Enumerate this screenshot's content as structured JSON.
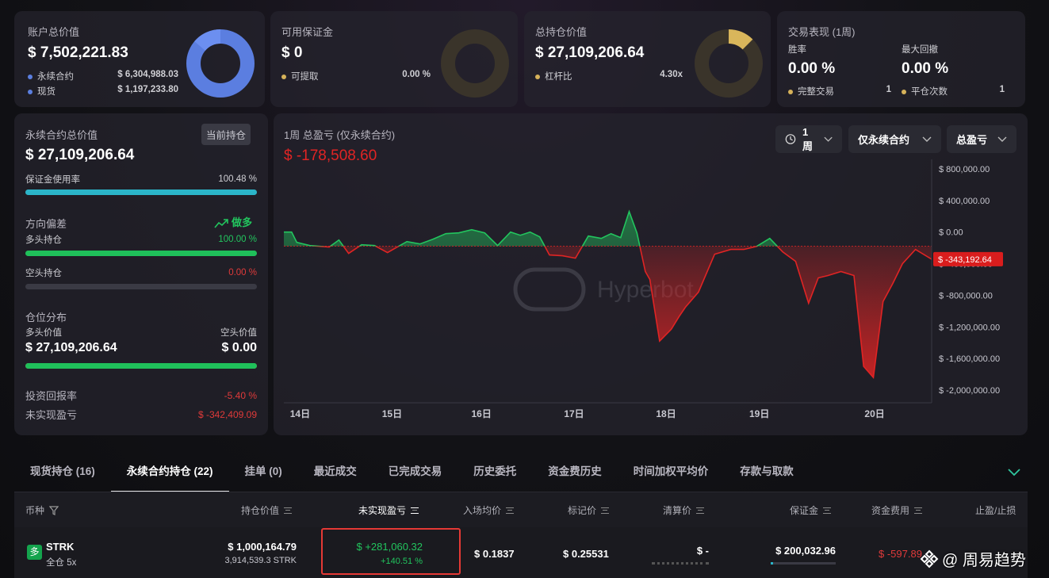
{
  "account": {
    "title": "账户总价值",
    "value": "$ 7,502,221.83",
    "perp_label": "永续合约",
    "perp_value": "$ 6,304,988.03",
    "spot_label": "现货",
    "spot_value": "$ 1,197,233.80",
    "perp_fraction": 0.84
  },
  "margin": {
    "title": "可用保证金",
    "value": "$ 0",
    "withdraw_label": "可提取",
    "withdraw_value": "0.00 %"
  },
  "position_value": {
    "title": "总持仓价值",
    "value": "$ 27,109,206.64",
    "leverage_label": "杠杆比",
    "leverage_value": "4.30x"
  },
  "performance": {
    "title": "交易表现 (1周)",
    "winrate_label": "胜率",
    "winrate_value": "0.00 %",
    "drawdown_label": "最大回撤",
    "drawdown_value": "0.00 %",
    "trades_label": "完整交易",
    "trades_value": "1",
    "closes_label": "平仓次数",
    "closes_value": "1"
  },
  "perp_panel": {
    "title": "永续合约总价值",
    "badge": "当前持仓",
    "value": "$ 27,109,206.64",
    "margin_usage_label": "保证金使用率",
    "margin_usage_value": "100.48 %",
    "margin_usage_fraction": 1.0,
    "bias_label": "方向偏差",
    "bias_value": "做多",
    "long_label": "多头持仓",
    "long_value": "100.00 %",
    "long_fraction": 1.0,
    "short_label": "空头持仓",
    "short_value": "0.00 %",
    "short_fraction": 0.0,
    "dist_label": "仓位分布",
    "long_value_label": "多头价值",
    "short_value_label": "空头价值",
    "long_amount": "$ 27,109,206.64",
    "short_amount": "$ 0.00",
    "dist_fraction": 1.0,
    "roi_label": "投资回报率",
    "roi_value": "-5.40 %",
    "upnl_label": "未实现盈亏",
    "upnl_value": "$ -342,409.09"
  },
  "chart_panel": {
    "title": "1周 总盈亏 (仅永续合约)",
    "value": "$ -178,508.60",
    "dd_period": "1周",
    "dd_scope": "仅永续合约",
    "dd_metric": "总盈亏",
    "watermark": "Hyperbot",
    "last_label": "$ -343,192.64",
    "colors": {
      "positive": "#22c55e",
      "negative": "#e02424"
    }
  },
  "chart_data": {
    "type": "area",
    "x_ticks": [
      "14日",
      "15日",
      "16日",
      "17日",
      "18日",
      "19日",
      "20日"
    ],
    "y_ticks": [
      "$ 800,000.00",
      "$ 400,000.00",
      "$ 0.00",
      "$ -400,000.00",
      "$ -800,000.00",
      "$ -1,200,000.00",
      "$ -1,600,000.00",
      "$ -2,000,000.00"
    ],
    "ylim": [
      -2000000,
      800000
    ],
    "xlim": [
      0,
      100
    ],
    "baseline": -178508.6,
    "x": [
      0,
      1.2,
      2,
      4,
      7,
      8.5,
      10,
      12,
      14,
      16,
      17.5,
      19,
      21,
      23,
      25,
      27,
      29,
      31,
      33,
      35,
      36.5,
      38,
      39.5,
      41,
      43,
      45,
      47,
      49,
      50.5,
      52,
      53.3,
      54.5,
      55.8,
      56.5,
      58,
      59.8,
      61,
      62,
      64,
      66.5,
      69,
      71,
      73,
      75,
      77,
      79,
      81,
      82.5,
      84,
      86,
      88,
      89.5,
      91,
      92.5,
      94,
      95.5,
      97.5,
      100
    ],
    "y": [
      0,
      0,
      -130000,
      -170000,
      -190000,
      -100000,
      -270000,
      -160000,
      -170000,
      -260000,
      -190000,
      -120000,
      -150000,
      -90000,
      -20000,
      -10000,
      30000,
      -10000,
      -170000,
      0,
      -40000,
      0,
      -60000,
      -290000,
      -300000,
      -330000,
      -50000,
      -80000,
      -20000,
      -70000,
      260000,
      -10000,
      -500000,
      -600000,
      -1380000,
      -1230000,
      -1070000,
      -950000,
      -760000,
      -280000,
      -220000,
      -220000,
      -180000,
      -80000,
      -250000,
      -370000,
      -900000,
      -580000,
      -550000,
      -500000,
      -550000,
      -1700000,
      -1840000,
      -880000,
      -650000,
      -400000,
      -220000,
      -343000
    ]
  },
  "tabs": [
    "现货持仓 (16)",
    "永续合约持仓 (22)",
    "挂单 (0)",
    "最近成交",
    "已完成交易",
    "历史委托",
    "资金费历史",
    "时间加权平均价",
    "存款与取款"
  ],
  "table": {
    "headers": [
      "币种",
      "持仓价值",
      "未实现盈亏",
      "入场均价",
      "标记价",
      "清算价",
      "保证金",
      "资金费用",
      "止盈/止损"
    ],
    "row": {
      "side_badge": "多",
      "symbol": "STRK",
      "mode": "全仓 5x",
      "value": "$ 1,000,164.79",
      "size": "3,914,539.3 STRK",
      "upnl": "$ +281,060.32",
      "upnl_pct": "+140.51 %",
      "entry": "$ 0.1837",
      "mark": "$ 0.25531",
      "liq": "$ -",
      "margin": "$ 200,032.96",
      "funding": "$ -597.89"
    }
  },
  "watermark_brand": "@ 周易趋势"
}
